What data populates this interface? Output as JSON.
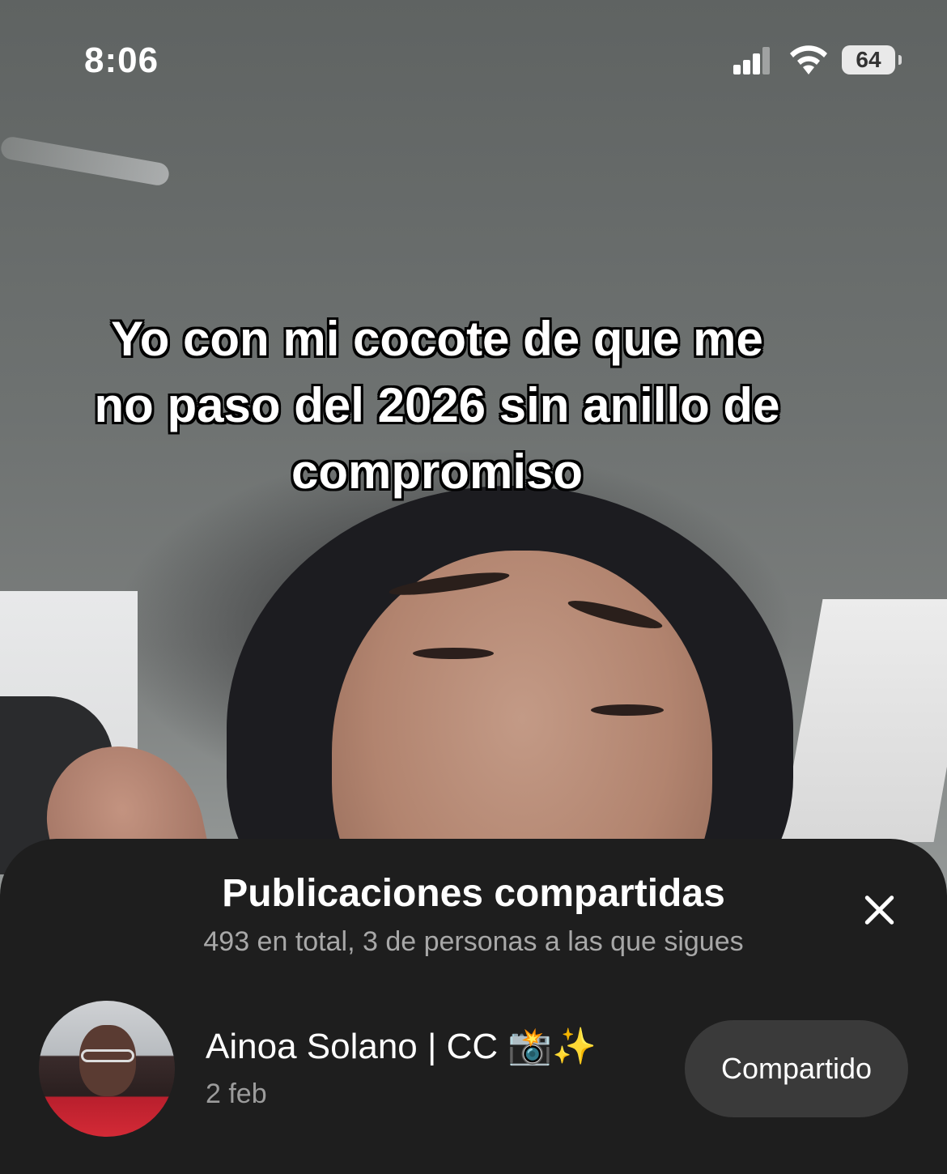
{
  "status_bar": {
    "time": "8:06",
    "battery": "64"
  },
  "video": {
    "caption": "Yo con mi cocote de que me no paso del 2026 sin anillo de compromiso"
  },
  "sheet": {
    "title": "Publicaciones compartidas",
    "subtitle": "493 en total, 3 de personas a las que sigues",
    "items": [
      {
        "name": "Ainoa Solano | CC 📸✨",
        "date": "2 feb",
        "button_label": "Compartido"
      }
    ]
  },
  "colors": {
    "sheet_bg": "#1e1e1e",
    "button_bg": "#3a3a3a",
    "subtitle_text": "#a8a8a8"
  }
}
